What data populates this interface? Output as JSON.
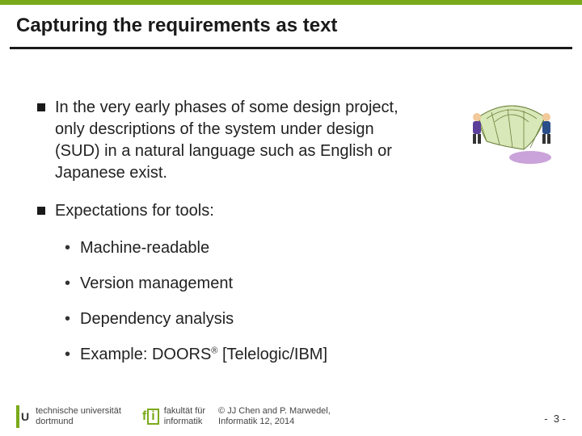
{
  "title": "Capturing the requirements as text",
  "bullets": [
    {
      "text": "In the very early phases of some design project, only descriptions of the system under design (SUD) in a natural language such as English or Japanese exist."
    },
    {
      "text": "Expectations for tools:",
      "subs": [
        "Machine-readable",
        "Version management",
        "Dependency analysis",
        "Example: DOORS® [Telelogic/IBM]"
      ]
    }
  ],
  "footer": {
    "uni_line1": "technische universität",
    "uni_line2": "dortmund",
    "fak_line1": "fakultät für",
    "fak_line2": "informatik",
    "copy_line1": "© JJ Chen and P. Marwedel,",
    "copy_line2": "Informatik 12,  2014"
  },
  "page": {
    "prefix": "-",
    "number": "3",
    "suffix": "-"
  },
  "clip_art": "people-throwing-net"
}
